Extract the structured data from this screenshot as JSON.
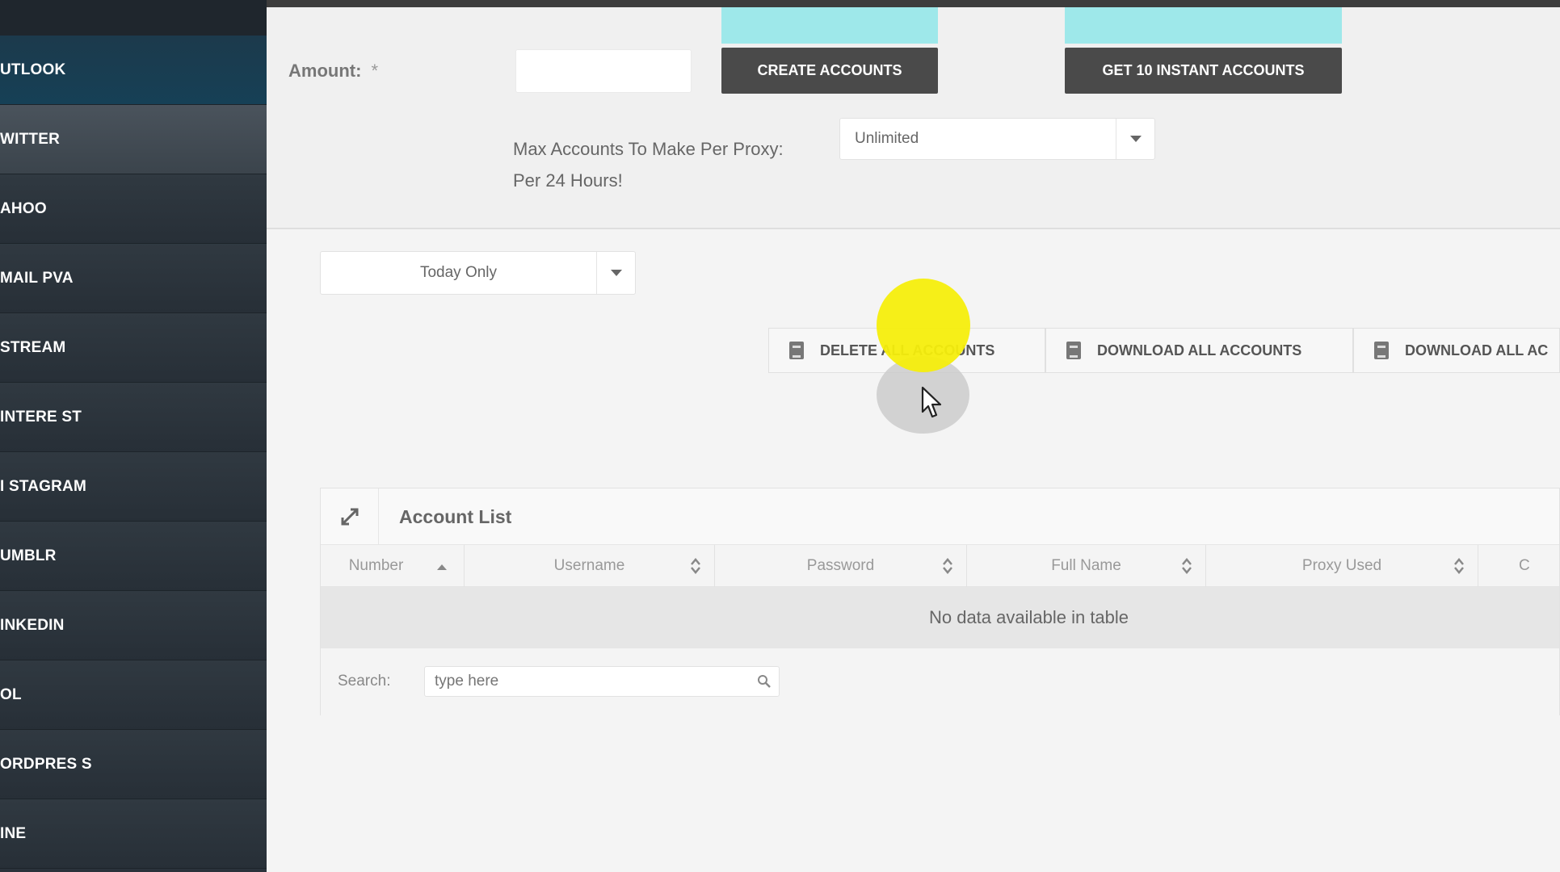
{
  "sidebar": {
    "items": [
      {
        "label": "UTLOOK"
      },
      {
        "label": "WITTER"
      },
      {
        "label": "AHOO"
      },
      {
        "label": "MAIL PVA"
      },
      {
        "label": "STREAM"
      },
      {
        "label": "INTERE ST"
      },
      {
        "label": "I STAGRAM"
      },
      {
        "label": "UMBLR"
      },
      {
        "label": "INKEDIN"
      },
      {
        "label": "OL"
      },
      {
        "label": "ORDPRES S"
      },
      {
        "label": "INE"
      }
    ]
  },
  "form": {
    "amount_label": "Amount:",
    "required_mark": "*",
    "amount_value": "",
    "create_button": "CREATE ACCOUNTS",
    "instant_button": "GET 10 INSTANT ACCOUNTS",
    "proxy_label_line1": "Max Accounts To Make Per Proxy:",
    "proxy_label_line2": "Per 24 Hours!",
    "proxy_select_value": "Unlimited"
  },
  "filter": {
    "range_select_value": "Today Only"
  },
  "actions": {
    "delete_all": "DELETE ALL ACCOUNTS",
    "download_all": "DOWNLOAD ALL ACCOUNTS",
    "download_all_2": "DOWNLOAD ALL AC"
  },
  "table": {
    "title": "Account List",
    "columns": [
      "Number",
      "Username",
      "Password",
      "Full Name",
      "Proxy Used",
      "C"
    ],
    "empty_message": "No data available in table",
    "search_label": "Search:",
    "search_placeholder": "type here"
  },
  "colors": {
    "sidebar_bg": "#2a323b",
    "sidebar_active": "#164056",
    "accent_cyan": "#9ee8ea",
    "dark_button": "#4a4a4a",
    "cursor_highlight": "#f5ee0c"
  }
}
